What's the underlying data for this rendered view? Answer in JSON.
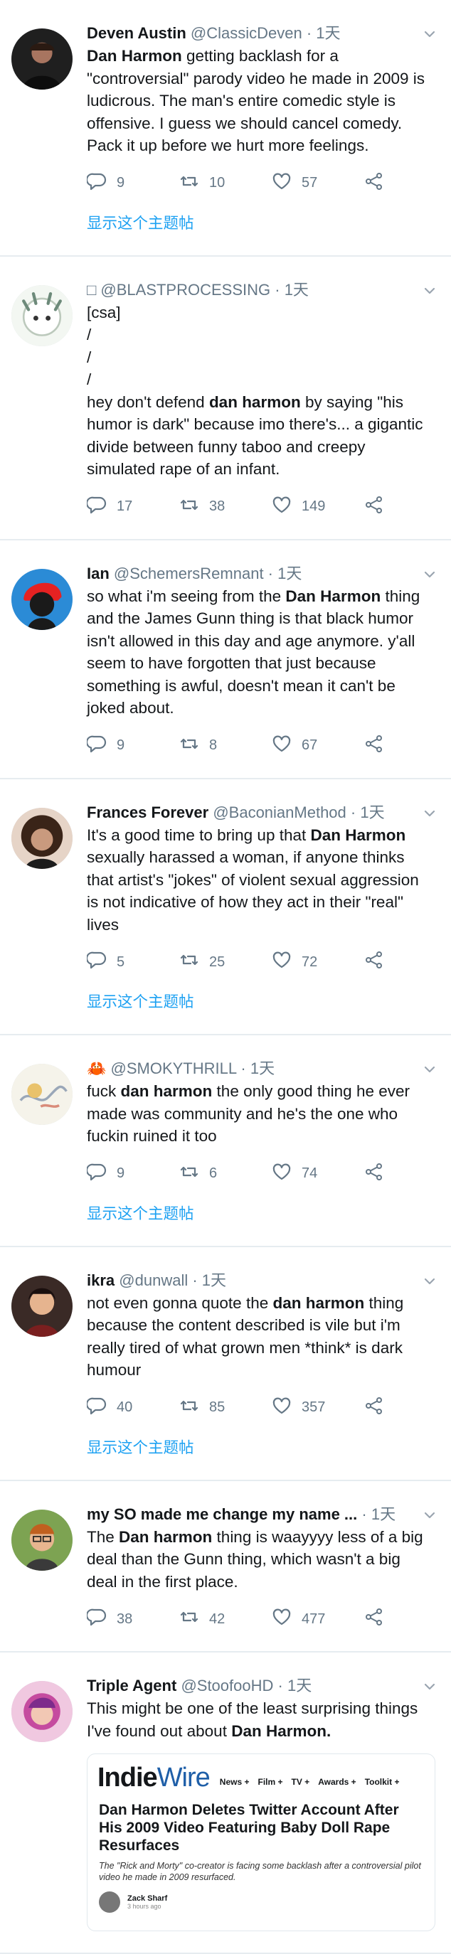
{
  "thread_link_label": "显示这个主题帖",
  "colors": {
    "accent": "#1da1f2",
    "muted": "#657786",
    "divider": "#e6ecf0"
  },
  "tweets": [
    {
      "display_name": "Deven Austin",
      "handle": "@ClassicDeven",
      "time": "1天",
      "avatar_icon": "avatar-dark-man",
      "body": [
        [
          {
            "t": "Dan Harmon",
            "b": true
          },
          {
            "t": " getting backlash for a \"controversial\" parody video he made in 2009 is ludicrous. The man's entire comedic style is offensive. I guess we should cancel comedy. Pack it up before we hurt more feelings."
          }
        ]
      ],
      "replies": "9",
      "retweets": "10",
      "likes": "57",
      "show_thread": true
    },
    {
      "display_name": "",
      "handle": "□ @BLASTPROCESSING",
      "time": "1天",
      "avatar_icon": "avatar-anime",
      "body": [
        [
          {
            "t": "[csa]"
          }
        ],
        [
          {
            "t": "/"
          }
        ],
        [
          {
            "t": "/"
          }
        ],
        [
          {
            "t": "/"
          }
        ],
        [
          {
            "t": "hey don't defend "
          },
          {
            "t": "dan harmon",
            "b": true
          },
          {
            "t": " by saying \"his humor is dark\" because imo there's... a gigantic divide between funny taboo and creepy simulated rape of an infant."
          }
        ]
      ],
      "replies": "17",
      "retweets": "38",
      "likes": "149",
      "show_thread": false
    },
    {
      "display_name": "Ian",
      "handle": "@SchemersRemnant",
      "time": "1天",
      "avatar_icon": "avatar-red-hair",
      "body": [
        [
          {
            "t": "so what i'm seeing from the "
          },
          {
            "t": "Dan Harmon",
            "b": true
          },
          {
            "t": " thing and the James Gunn thing is that black humor isn't allowed in this day and age anymore. y'all seem to have forgotten that just because something is awful, doesn't mean it can't be joked about."
          }
        ]
      ],
      "replies": "9",
      "retweets": "8",
      "likes": "67",
      "show_thread": false
    },
    {
      "display_name": "Frances Forever",
      "handle": "@BaconianMethod",
      "time": "1天",
      "avatar_icon": "avatar-curly-hair",
      "body": [
        [
          {
            "t": "It's a good time to bring up that "
          },
          {
            "t": "Dan Harmon",
            "b": true
          },
          {
            "t": " sexually harassed a woman, if anyone thinks that artist's \"jokes\" of violent sexual aggression is not indicative of how they act in their \"real\" lives"
          }
        ]
      ],
      "replies": "5",
      "retweets": "25",
      "likes": "72",
      "show_thread": true
    },
    {
      "display_name": "",
      "handle": "🦀 @SMOKYTHRILL",
      "time": "1天",
      "avatar_icon": "avatar-sketch",
      "body": [
        [
          {
            "t": "fuck "
          },
          {
            "t": "dan harmon",
            "b": true
          },
          {
            "t": " the only good thing he ever made was community and he's the one who fuckin ruined it too"
          }
        ]
      ],
      "replies": "9",
      "retweets": "6",
      "likes": "74",
      "show_thread": true
    },
    {
      "display_name": "ikra",
      "handle": "@dunwall",
      "time": "1天",
      "avatar_icon": "avatar-illustrated",
      "body": [
        [
          {
            "t": "not even gonna quote the "
          },
          {
            "t": "dan harmon",
            "b": true
          },
          {
            "t": " thing because the content described is vile but i'm really tired of what grown men *think* is dark humour"
          }
        ]
      ],
      "replies": "40",
      "retweets": "85",
      "likes": "357",
      "show_thread": true
    },
    {
      "display_name": "my SO made me change my name ...",
      "handle": "",
      "time": "1天",
      "avatar_icon": "avatar-glasses",
      "body": [
        [
          {
            "t": "The "
          },
          {
            "t": "Dan harmon",
            "b": true
          },
          {
            "t": " thing is waayyyy less of a big deal than the Gunn thing, which wasn't a big deal in the first place."
          }
        ]
      ],
      "replies": "38",
      "retweets": "42",
      "likes": "477",
      "show_thread": false
    },
    {
      "display_name": "Triple Agent",
      "handle": "@StoofooHD",
      "time": "1天",
      "avatar_icon": "avatar-pink",
      "body": [
        [
          {
            "t": "This might be one of the least surprising things I've found out about "
          },
          {
            "t": "Dan Harmon.",
            "b": true
          }
        ]
      ],
      "show_thread": false,
      "card": {
        "logo_a": "Indie",
        "logo_b": "Wire",
        "nav": [
          "News +",
          "Film +",
          "TV +",
          "Awards +",
          "Toolkit +"
        ],
        "headline": "Dan Harmon Deletes Twitter Account After His 2009 Video Featuring Baby Doll Rape Resurfaces",
        "deck": "The \"Rick and Morty\" co-creator is facing some backlash after a controversial pilot video he made in 2009 resurfaced.",
        "author": "Zack Sharf",
        "ago": "3 hours ago"
      }
    }
  ]
}
